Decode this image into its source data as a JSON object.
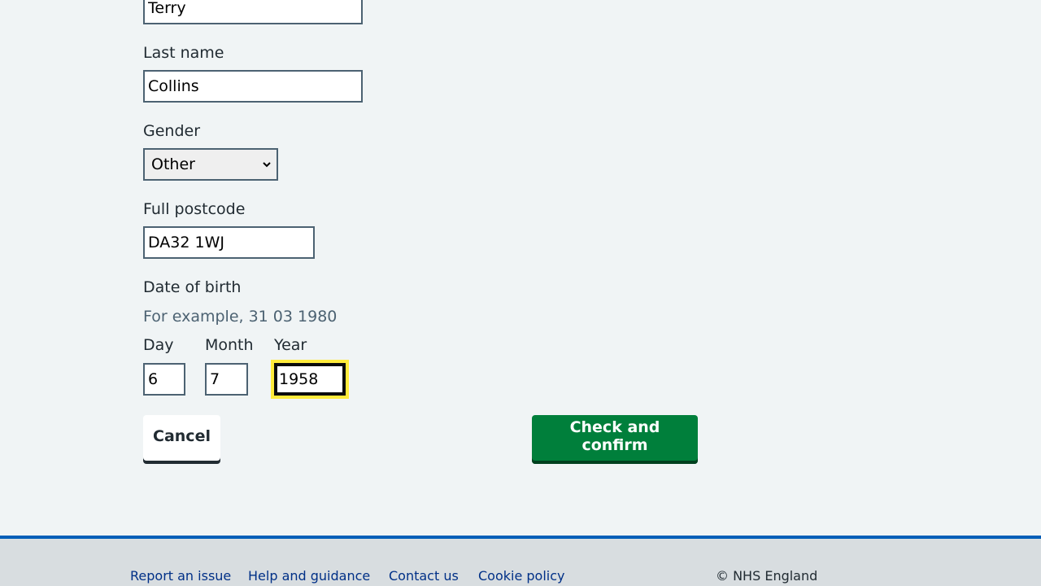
{
  "form": {
    "first_name_value": "Terry",
    "last_name_label": "Last name",
    "last_name_value": "Collins",
    "gender_label": "Gender",
    "gender_value": "Other",
    "postcode_label": "Full postcode",
    "postcode_value": "DA32 1WJ",
    "dob_label": "Date of birth",
    "dob_hint": "For example, 31 03 1980",
    "day_label": "Day",
    "day_value": "6",
    "month_label": "Month",
    "month_value": "7",
    "year_label": "Year",
    "year_value": "1958"
  },
  "actions": {
    "cancel_label": "Cancel",
    "confirm_label": "Check and confirm"
  },
  "footer": {
    "links": [
      "Report an issue",
      "Help and guidance",
      "Contact us",
      "Cookie policy"
    ],
    "copyright": "© NHS England"
  },
  "colors": {
    "background": "#f0f4f5",
    "input_border": "#4c6272",
    "focus": "#ffeb3b",
    "primary_button": "#007f3b",
    "footer_border": "#005eb8",
    "footer_bg": "#d8dde0",
    "link": "#003087"
  }
}
